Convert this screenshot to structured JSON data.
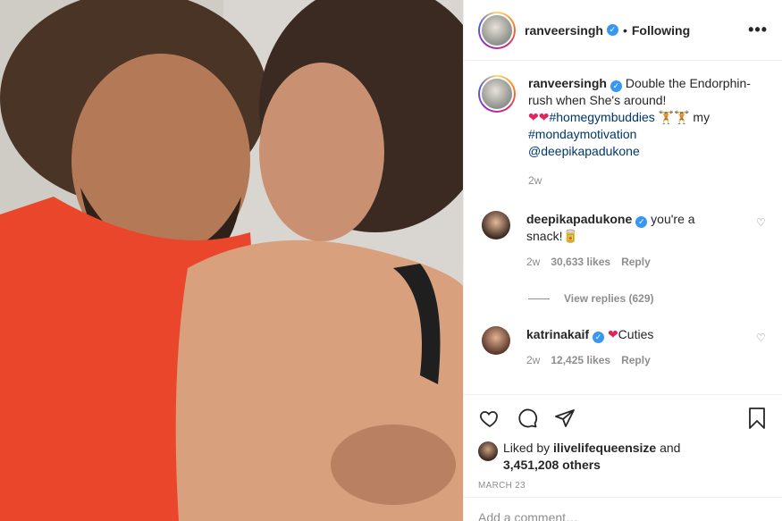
{
  "post": {
    "author": "ranveersingh",
    "following_label": "Following",
    "separator": "•",
    "more_icon": "•••"
  },
  "caption": {
    "username": "ranveersingh",
    "line1": "Double the",
    "line2": "Endorphin-rush when She's around!",
    "hearts": "❤❤",
    "hashtag1": "#homegymbuddies",
    "emoji": "🏋🏋",
    "word_my": "my",
    "hashtag2": "#mondaymotivation",
    "mention": "@deepikapadukone",
    "time": "2w"
  },
  "comments": [
    {
      "username": "deepikapadukone",
      "text": "you're a",
      "text2": "snack!",
      "emoji": "🥫",
      "time": "2w",
      "likes": "30,633 likes",
      "reply": "Reply",
      "view_replies": "View replies (629)"
    },
    {
      "username": "katrinakaif",
      "emoji": "❤",
      "text": "Cuties",
      "time": "2w",
      "likes": "12,425 likes",
      "reply": "Reply"
    }
  ],
  "liked_by": {
    "prefix": "Liked by",
    "user": "ilivelifequeensize",
    "and": "and",
    "others": "3,451,208 others"
  },
  "date": "MARCH 23",
  "add_comment_placeholder": "Add a comment…",
  "colors": {
    "verified": "#3897f0",
    "heart": "#e0245e",
    "muted": "#8e8e8e"
  }
}
